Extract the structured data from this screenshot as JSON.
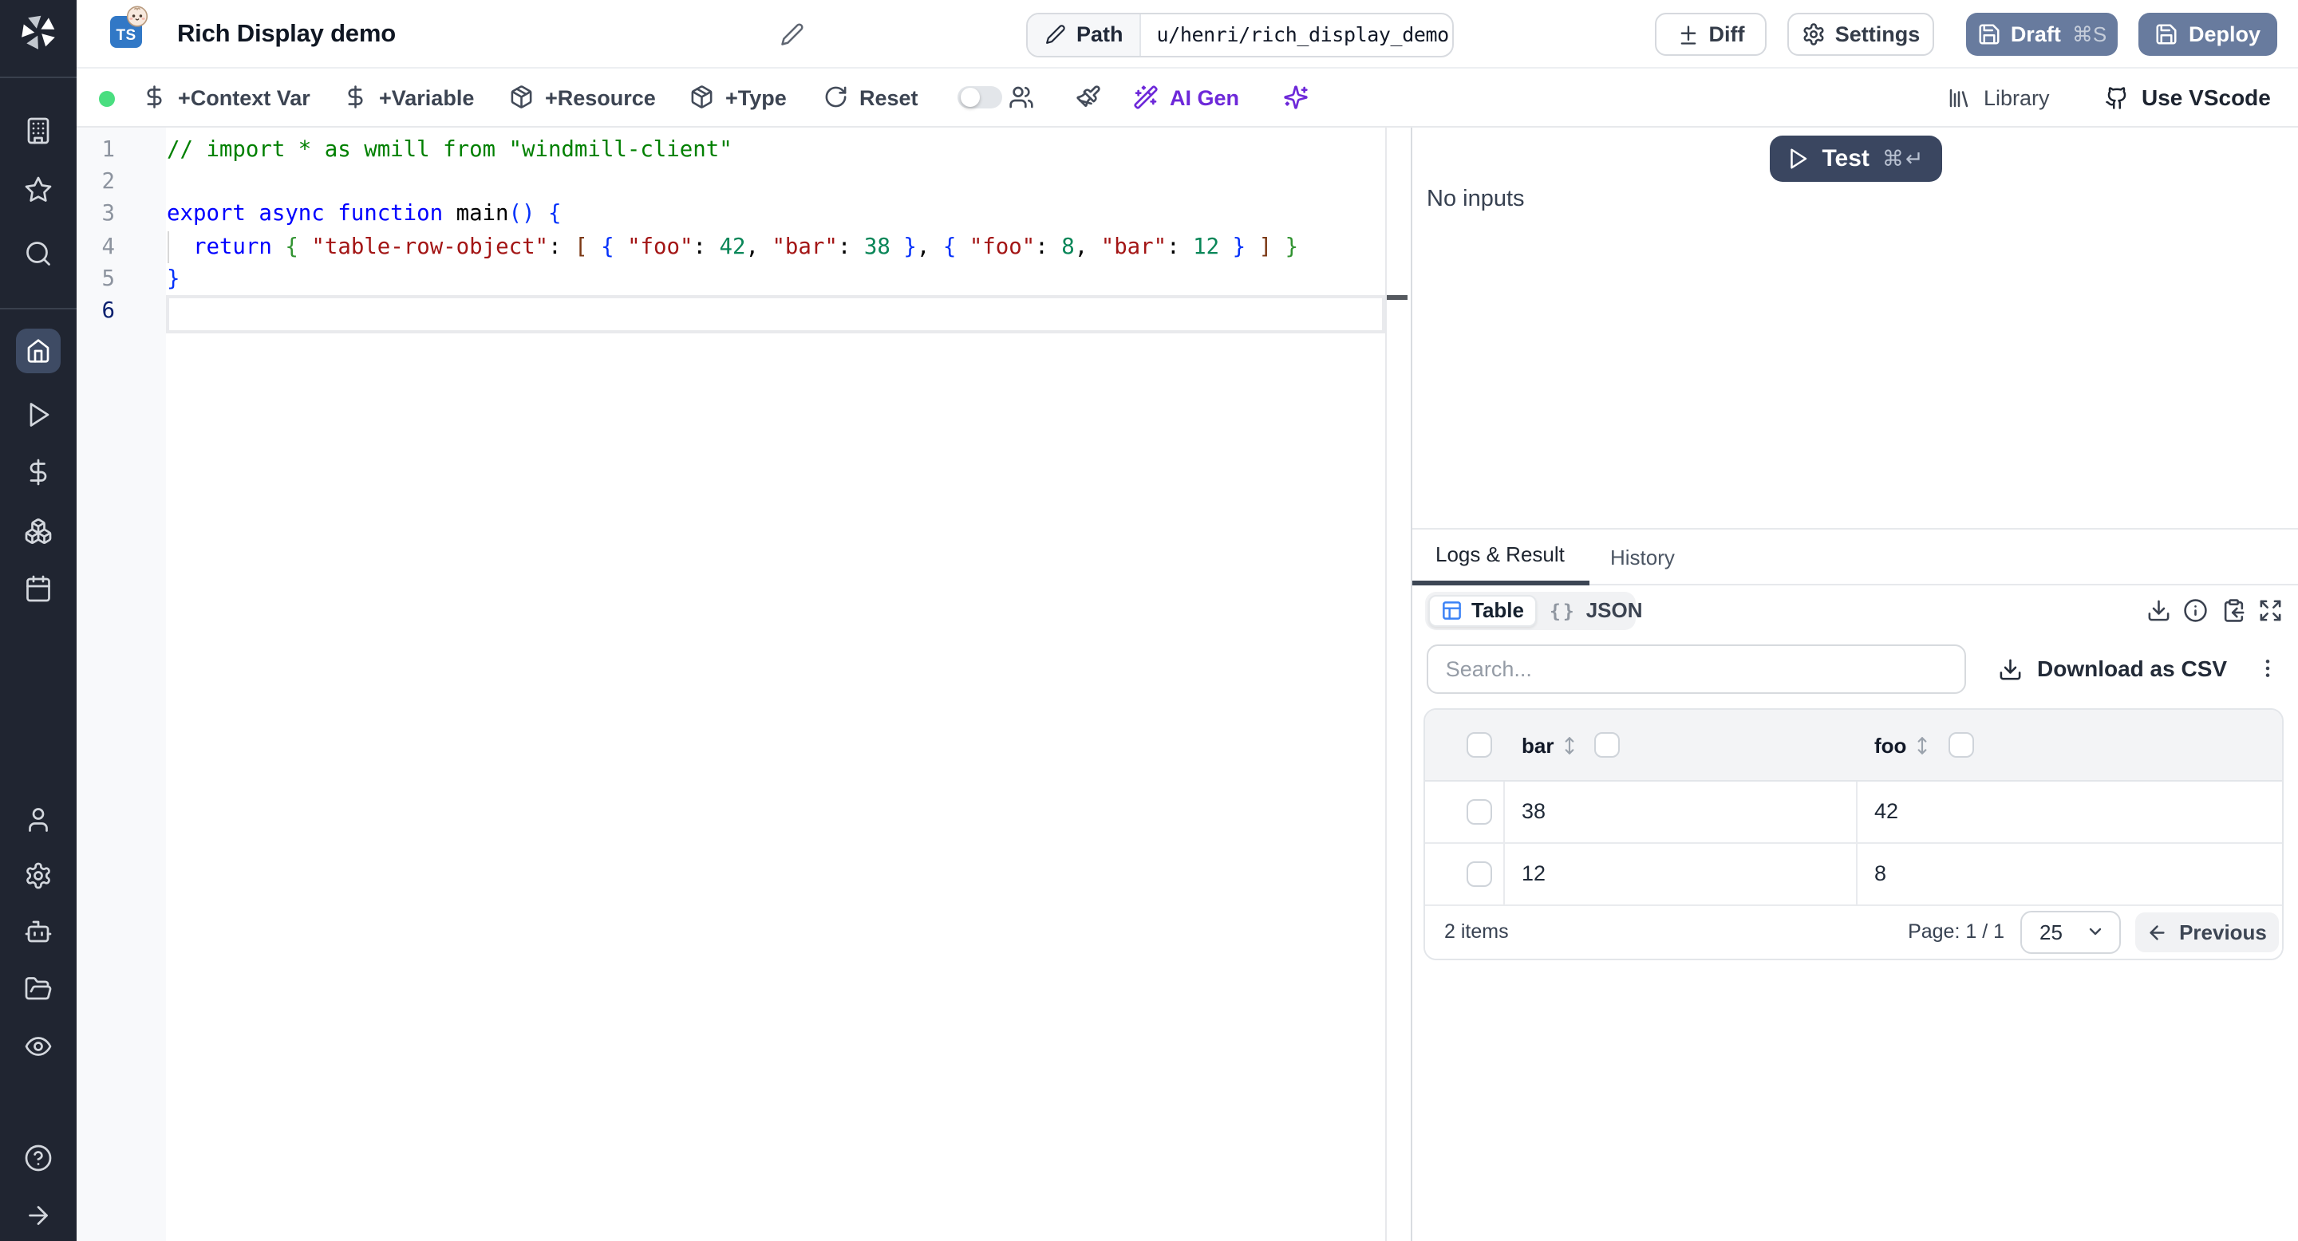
{
  "colors": {
    "sidebar_bg": "#202531",
    "active_item_bg": "#3e4b64",
    "accent_blue": "#3b82f6",
    "slate_button": "#697da0",
    "test_button": "#3a4660",
    "ai_purple": "#6d28d9",
    "status_green": "#4ade80"
  },
  "sidebar": {
    "logo": "windmill-logo",
    "top_items": [
      {
        "icon": "building-icon",
        "name": "workspace"
      },
      {
        "icon": "star-icon",
        "name": "favorites"
      },
      {
        "icon": "search-icon",
        "name": "search"
      }
    ],
    "main_items": [
      {
        "icon": "home-icon",
        "name": "home",
        "active": true
      },
      {
        "icon": "play-icon",
        "name": "runs"
      },
      {
        "icon": "dollar-icon",
        "name": "variables"
      },
      {
        "icon": "boxes-icon",
        "name": "resources"
      },
      {
        "icon": "calendar-icon",
        "name": "schedules"
      }
    ],
    "bottom_items": [
      {
        "icon": "user-icon",
        "name": "account"
      },
      {
        "icon": "gear-icon",
        "name": "workspace-settings"
      },
      {
        "icon": "bot-icon",
        "name": "workers"
      },
      {
        "icon": "folder-icon",
        "name": "folders"
      },
      {
        "icon": "eye-icon",
        "name": "audit-logs"
      }
    ],
    "footer_items": [
      {
        "icon": "help-circle-icon",
        "name": "help"
      },
      {
        "icon": "arrow-right-icon",
        "name": "expand-sidebar"
      }
    ]
  },
  "header": {
    "language_badge": "TS",
    "runtime_icon": "bun-icon",
    "title": "Rich Display demo",
    "path_label": "Path",
    "path_value": "u/henri/rich_display_demo",
    "diff_label": "Diff",
    "settings_label": "Settings",
    "draft_label": "Draft",
    "draft_shortcut": "⌘S",
    "deploy_label": "Deploy"
  },
  "toolbar": {
    "items": [
      {
        "icon": "dollar-icon",
        "label": "+Context Var"
      },
      {
        "icon": "dollar-icon",
        "label": "+Variable"
      },
      {
        "icon": "package-icon",
        "label": "+Resource"
      },
      {
        "icon": "package-icon",
        "label": "+Type"
      },
      {
        "icon": "rotate-cw-icon",
        "label": "Reset"
      }
    ],
    "ai_gen_label": "AI Gen",
    "library_label": "Library",
    "vscode_label": "Use VScode"
  },
  "editor": {
    "active_line": 6,
    "lines": [
      {
        "num": "1",
        "tokens": [
          [
            "// import * as wmill from \"windmill-client\"",
            "comment"
          ]
        ]
      },
      {
        "num": "2",
        "tokens": []
      },
      {
        "num": "3",
        "tokens": [
          [
            "export async function ",
            "kw"
          ],
          [
            "main",
            "fn"
          ],
          [
            "()",
            "b1"
          ],
          [
            " ",
            "pun"
          ],
          [
            "{",
            "b1"
          ]
        ]
      },
      {
        "num": "4",
        "tokens": [
          [
            "  ",
            "pun"
          ],
          [
            "return",
            "kw"
          ],
          [
            " ",
            "pun"
          ],
          [
            "{",
            "b2"
          ],
          [
            " ",
            "pun"
          ],
          [
            "\"table-row-object\"",
            "str"
          ],
          [
            ":",
            "pun"
          ],
          [
            " ",
            "pun"
          ],
          [
            "[",
            "b3"
          ],
          [
            " ",
            "pun"
          ],
          [
            "{",
            "b1"
          ],
          [
            " ",
            "pun"
          ],
          [
            "\"foo\"",
            "str"
          ],
          [
            ":",
            "pun"
          ],
          [
            " ",
            "pun"
          ],
          [
            "42",
            "num"
          ],
          [
            ",",
            "pun"
          ],
          [
            " ",
            "pun"
          ],
          [
            "\"bar\"",
            "str"
          ],
          [
            ":",
            "pun"
          ],
          [
            " ",
            "pun"
          ],
          [
            "38",
            "num"
          ],
          [
            " ",
            "pun"
          ],
          [
            "}",
            "b1"
          ],
          [
            ",",
            "pun"
          ],
          [
            " ",
            "pun"
          ],
          [
            "{",
            "b1"
          ],
          [
            " ",
            "pun"
          ],
          [
            "\"foo\"",
            "str"
          ],
          [
            ":",
            "pun"
          ],
          [
            " ",
            "pun"
          ],
          [
            "8",
            "num"
          ],
          [
            ",",
            "pun"
          ],
          [
            " ",
            "pun"
          ],
          [
            "\"bar\"",
            "str"
          ],
          [
            ":",
            "pun"
          ],
          [
            " ",
            "pun"
          ],
          [
            "12",
            "num"
          ],
          [
            " ",
            "pun"
          ],
          [
            "}",
            "b1"
          ],
          [
            " ",
            "pun"
          ],
          [
            "]",
            "b3"
          ],
          [
            " ",
            "pun"
          ],
          [
            "}",
            "b2"
          ]
        ]
      },
      {
        "num": "5",
        "tokens": [
          [
            "}",
            "b1"
          ]
        ]
      },
      {
        "num": "6",
        "tokens": []
      }
    ]
  },
  "run_panel": {
    "test_label": "Test",
    "test_shortcut": "⌘↵",
    "no_inputs": "No inputs"
  },
  "tabs": {
    "logs_result": "Logs & Result",
    "history": "History"
  },
  "result": {
    "view_table_label": "Table",
    "view_json_label": "JSON",
    "braces_glyph": "{}",
    "search_placeholder": "Search...",
    "download_csv_label": "Download as CSV",
    "table": {
      "columns": [
        "bar",
        "foo"
      ],
      "rows": [
        [
          "38",
          "42"
        ],
        [
          "12",
          "8"
        ]
      ]
    },
    "footer": {
      "items_count": "2 items",
      "page_label": "Page: 1 / 1",
      "page_size": "25",
      "previous_label": "Previous"
    }
  }
}
